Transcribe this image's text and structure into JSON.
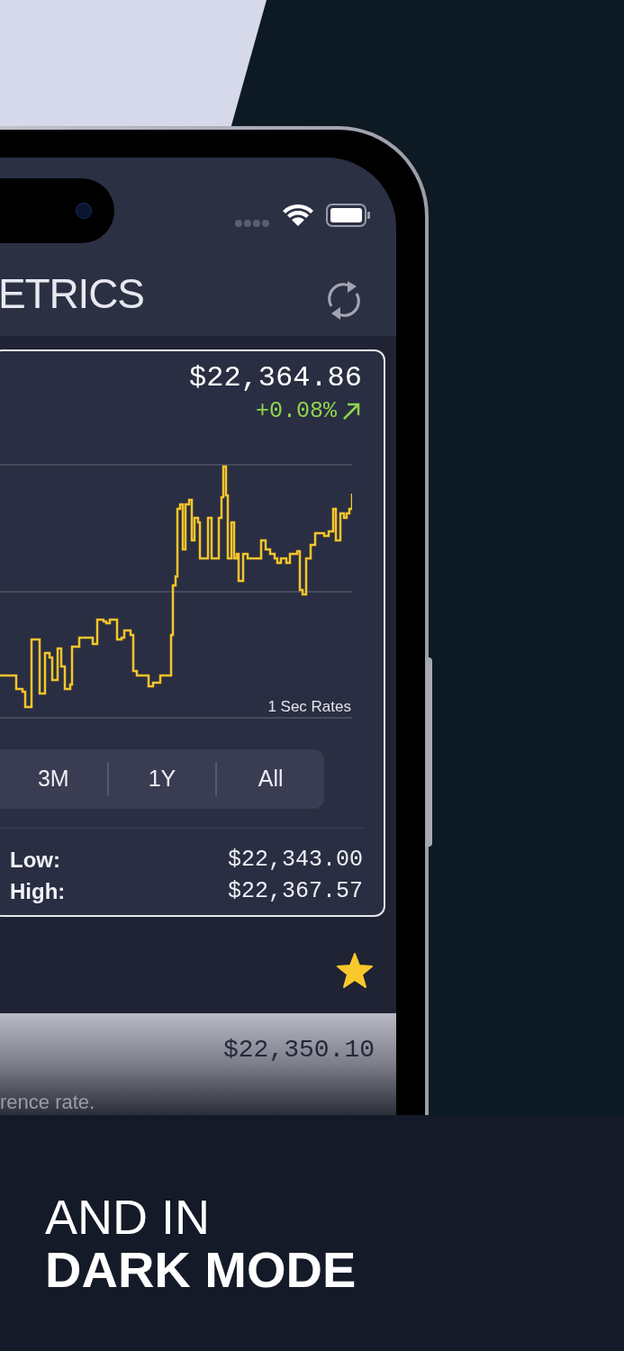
{
  "header": {
    "title": "ETRICS"
  },
  "price_card": {
    "price": "$22,364.86",
    "change": "+0.08%",
    "rising": true,
    "chart_caption": "1 Sec Rates",
    "ranges": [
      {
        "label": "3M",
        "selected": false
      },
      {
        "label": "1Y",
        "selected": false
      },
      {
        "label": "All",
        "selected": false
      }
    ],
    "stats": [
      {
        "label": "Low:",
        "value": "$22,343.00"
      },
      {
        "label": "High:",
        "value": "$22,367.57"
      }
    ]
  },
  "favorite": {
    "on": true
  },
  "rate_row": {
    "value": "$22,350.10",
    "note": "rence rate."
  },
  "promo": {
    "line_1": "AND IN",
    "line_2": "DARK MODE"
  }
}
